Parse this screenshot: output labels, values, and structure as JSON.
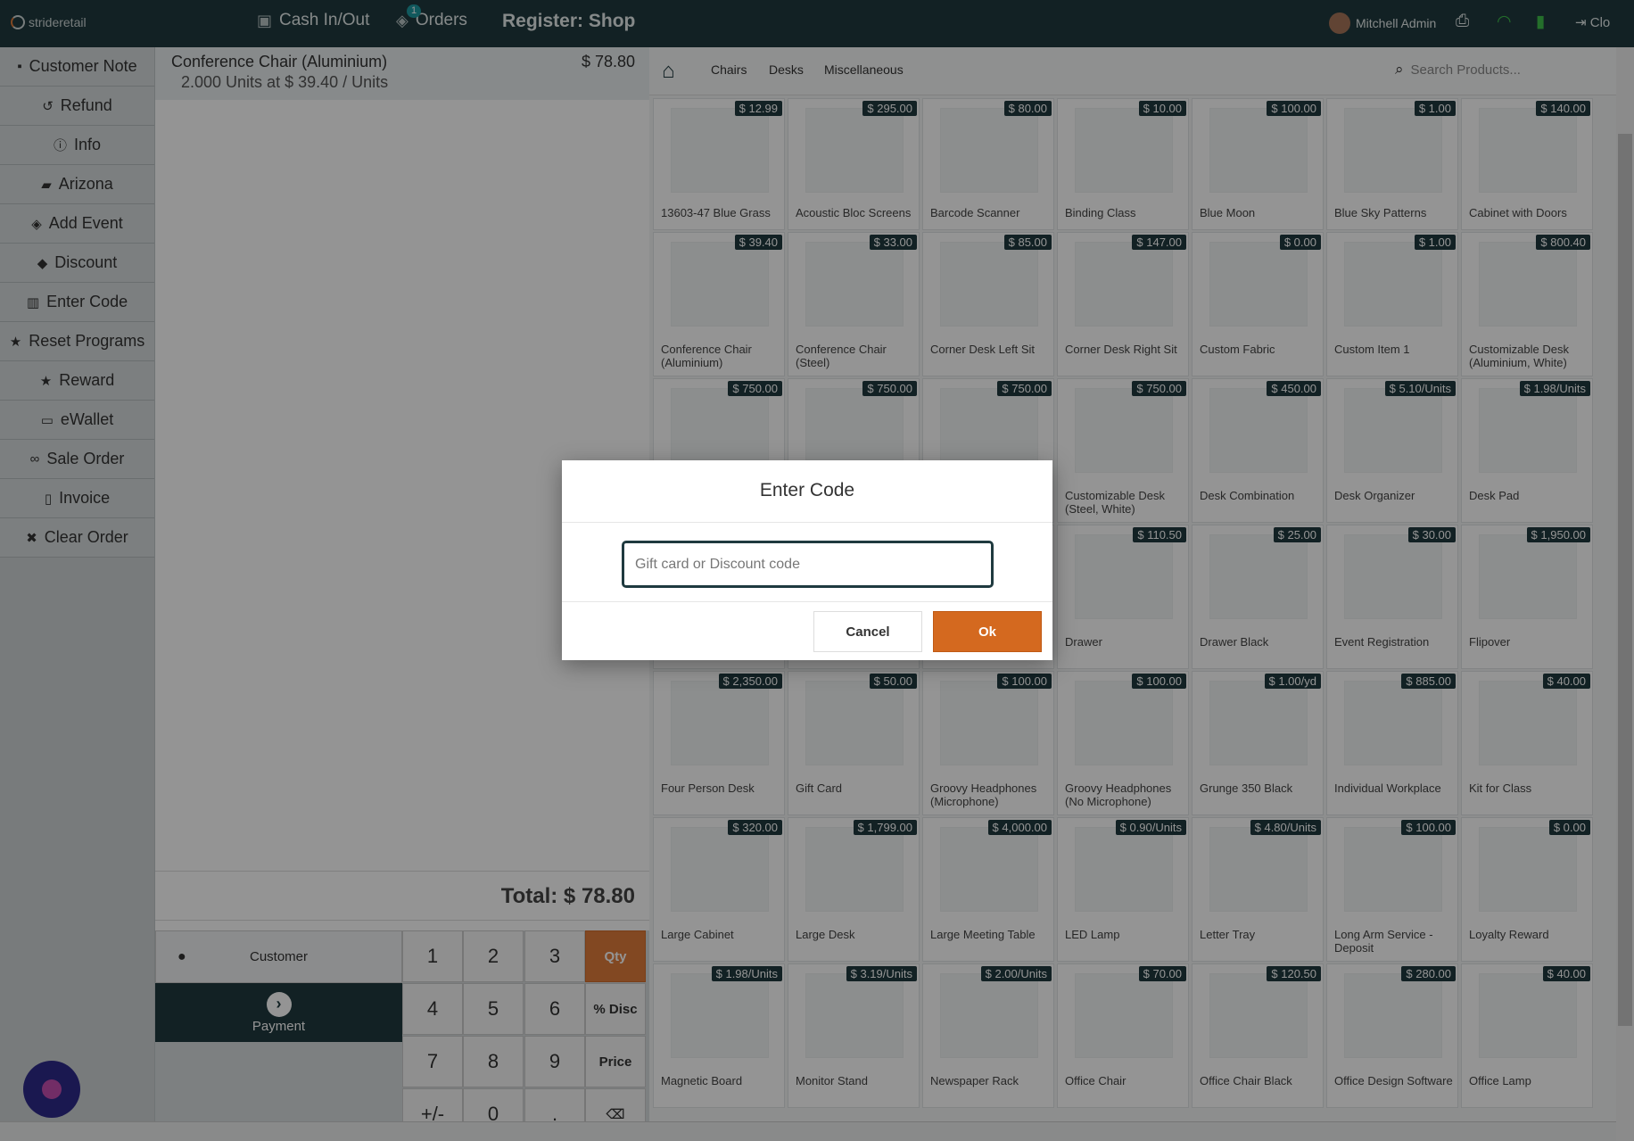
{
  "topbar": {
    "logo": "strideretail",
    "cash": "Cash In/Out",
    "orders": "Orders",
    "orders_badge": "1",
    "register": "Register: Shop",
    "user": "Mitchell Admin",
    "close": "Clo"
  },
  "actions": [
    {
      "label": "Customer Note",
      "icon": "note-icon",
      "glyph": "▪"
    },
    {
      "label": "Refund",
      "icon": "undo-icon",
      "glyph": "↺"
    },
    {
      "label": "Info",
      "icon": "info-icon",
      "glyph": "ⓘ"
    },
    {
      "label": "Arizona",
      "icon": "book-icon",
      "glyph": "▰"
    },
    {
      "label": "Add Event",
      "icon": "ticket-icon",
      "glyph": "◈"
    },
    {
      "label": "Discount",
      "icon": "tag-icon",
      "glyph": "◆"
    },
    {
      "label": "Enter Code",
      "icon": "barcode-icon",
      "glyph": "▥"
    },
    {
      "label": "Reset Programs",
      "icon": "star-icon",
      "glyph": "★"
    },
    {
      "label": "Reward",
      "icon": "star-icon",
      "glyph": "★"
    },
    {
      "label": "eWallet",
      "icon": "card-icon",
      "glyph": "▭"
    },
    {
      "label": "Sale Order",
      "icon": "link-icon",
      "glyph": "∞"
    },
    {
      "label": "Invoice",
      "icon": "file-icon",
      "glyph": "▯"
    },
    {
      "label": "Clear Order",
      "icon": "close-icon",
      "glyph": "✖"
    }
  ],
  "order": {
    "line_name": "Conference Chair (Aluminium)",
    "line_price": "$ 78.80",
    "line_qty": "2.000 Units at $ 39.40 / Units",
    "total": "Total: $ 78.80"
  },
  "pad": {
    "customer": "Customer",
    "payment": "Payment",
    "keys": [
      "1",
      "2",
      "3",
      "Qty",
      "4",
      "5",
      "6",
      "% Disc",
      "7",
      "8",
      "9",
      "Price",
      "+/-",
      "0",
      ".",
      "⌫"
    ],
    "active_mode": "Qty"
  },
  "categories": {
    "items": [
      "Chairs",
      "Desks",
      "Miscellaneous"
    ],
    "search_placeholder": "Search Products..."
  },
  "products": [
    {
      "name": "13603-47 Blue Grass",
      "price": "$ 12.99"
    },
    {
      "name": "Acoustic Bloc Screens",
      "price": "$ 295.00"
    },
    {
      "name": "Barcode Scanner",
      "price": "$ 80.00"
    },
    {
      "name": "Binding Class",
      "price": "$ 10.00"
    },
    {
      "name": "Blue Moon",
      "price": "$ 100.00"
    },
    {
      "name": "Blue Sky Patterns",
      "price": "$ 1.00"
    },
    {
      "name": "Cabinet with Doors",
      "price": "$ 140.00"
    },
    {
      "name": "Conference Chair (Aluminium)",
      "price": "$ 39.40"
    },
    {
      "name": "Conference Chair (Steel)",
      "price": "$ 33.00"
    },
    {
      "name": "Corner Desk Left Sit",
      "price": "$ 85.00"
    },
    {
      "name": "Corner Desk Right Sit",
      "price": "$ 147.00"
    },
    {
      "name": "Custom Fabric",
      "price": "$ 0.00"
    },
    {
      "name": "Custom Item 1",
      "price": "$ 1.00"
    },
    {
      "name": "Customizable Desk (Aluminium, White)",
      "price": "$ 800.40"
    },
    {
      "name": "",
      "price": "$ 750.00"
    },
    {
      "name": "",
      "price": "$ 750.00"
    },
    {
      "name": "",
      "price": "$ 750.00"
    },
    {
      "name": "Customizable Desk (Steel, White)",
      "price": "$ 750.00"
    },
    {
      "name": "Desk Combination",
      "price": "$ 450.00"
    },
    {
      "name": "Desk Organizer",
      "price": "$ 5.10/Units"
    },
    {
      "name": "Desk Pad",
      "price": "$ 1.98/Units"
    },
    {
      "name": "",
      "price": ""
    },
    {
      "name": "",
      "price": ""
    },
    {
      "name": "",
      "price": ""
    },
    {
      "name": "Drawer",
      "price": "$ 110.50"
    },
    {
      "name": "Drawer Black",
      "price": "$ 25.00"
    },
    {
      "name": "Event Registration",
      "price": "$ 30.00"
    },
    {
      "name": "Flipover",
      "price": "$ 1,950.00"
    },
    {
      "name": "Four Person Desk",
      "price": "$ 2,350.00"
    },
    {
      "name": "Gift Card",
      "price": "$ 50.00"
    },
    {
      "name": "Groovy Headphones (Microphone)",
      "price": "$ 100.00"
    },
    {
      "name": "Groovy Headphones (No Microphone)",
      "price": "$ 100.00"
    },
    {
      "name": "Grunge 350 Black",
      "price": "$ 1.00/yd"
    },
    {
      "name": "Individual Workplace",
      "price": "$ 885.00"
    },
    {
      "name": "Kit for Class",
      "price": "$ 40.00"
    },
    {
      "name": "Large Cabinet",
      "price": "$ 320.00"
    },
    {
      "name": "Large Desk",
      "price": "$ 1,799.00"
    },
    {
      "name": "Large Meeting Table",
      "price": "$ 4,000.00"
    },
    {
      "name": "LED Lamp",
      "price": "$ 0.90/Units"
    },
    {
      "name": "Letter Tray",
      "price": "$ 4.80/Units"
    },
    {
      "name": "Long Arm Service - Deposit",
      "price": "$ 100.00"
    },
    {
      "name": "Loyalty Reward",
      "price": "$ 0.00"
    },
    {
      "name": "Magnetic Board",
      "price": "$ 1.98/Units"
    },
    {
      "name": "Monitor Stand",
      "price": "$ 3.19/Units"
    },
    {
      "name": "Newspaper Rack",
      "price": "$ 2.00/Units"
    },
    {
      "name": "Office Chair",
      "price": "$ 70.00"
    },
    {
      "name": "Office Chair Black",
      "price": "$ 120.50"
    },
    {
      "name": "Office Design Software",
      "price": "$ 280.00"
    },
    {
      "name": "Office Lamp",
      "price": "$ 40.00"
    }
  ],
  "modal": {
    "title": "Enter Code",
    "placeholder": "Gift card or Discount code",
    "cancel": "Cancel",
    "ok": "Ok"
  }
}
